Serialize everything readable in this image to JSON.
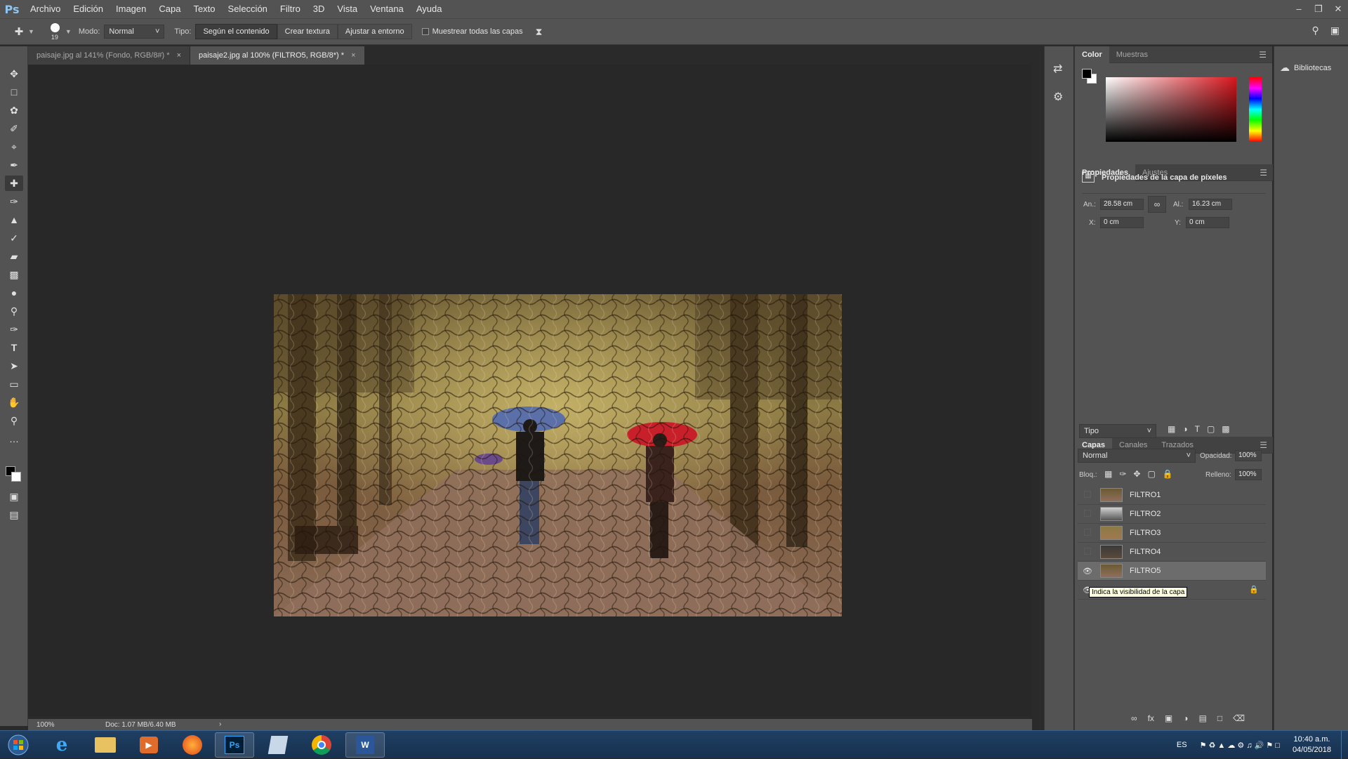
{
  "app": {
    "logo": "Ps"
  },
  "menu": [
    "Archivo",
    "Edición",
    "Imagen",
    "Capa",
    "Texto",
    "Selección",
    "Filtro",
    "3D",
    "Vista",
    "Ventana",
    "Ayuda"
  ],
  "options": {
    "brush_size": "19",
    "mode_label": "Modo:",
    "mode_value": "Normal",
    "type_label": "Tipo:",
    "type_buttons": [
      "Según el contenido",
      "Crear textura",
      "Ajustar a entorno"
    ],
    "sample_all_label": "Muestrear todas las capas"
  },
  "tabs": [
    {
      "label": "paisaje.jpg al 141% (Fondo, RGB/8#) *"
    },
    {
      "label": "paisaje2.jpg al 100% (FILTRO5, RGB/8*) *"
    }
  ],
  "status": {
    "zoom": "100%",
    "doc": "Doc: 1.07 MB/6.40 MB"
  },
  "color_panel": {
    "tabs": [
      "Color",
      "Muestras"
    ]
  },
  "properties_panel": {
    "tabs": [
      "Propiedades",
      "Ajustes"
    ],
    "title": "Propiedades de la capa de píxeles",
    "w_label": "An.:",
    "w_value": "28.58 cm",
    "h_label": "Al.:",
    "h_value": "16.23 cm",
    "x_label": "X:",
    "x_value": "0 cm",
    "y_label": "Y:",
    "y_value": "0 cm"
  },
  "layers_panel": {
    "tabs": [
      "Capas",
      "Canales",
      "Trazados"
    ],
    "filter_kind": "Tipo",
    "blend_mode": "Normal",
    "opacity_label": "Opacidad:",
    "opacity_value": "100%",
    "lock_label": "Bloq.:",
    "fill_label": "Relleno:",
    "fill_value": "100%",
    "layers": [
      {
        "name": "FILTRO1",
        "visible": false
      },
      {
        "name": "FILTRO2",
        "visible": false
      },
      {
        "name": "FILTRO3",
        "visible": false
      },
      {
        "name": "FILTRO4",
        "visible": false
      },
      {
        "name": "FILTRO5",
        "visible": true,
        "selected": true
      }
    ],
    "tooltip": "Indica la visibilidad de la capa"
  },
  "libraries": {
    "label": "Bibliotecas"
  },
  "taskbar": {
    "lang": "ES",
    "time": "10:40 a.m.",
    "date": "04/05/2018"
  },
  "colors": {
    "accent_red": "#c8202a",
    "ps_blue": "#31a8ff"
  }
}
